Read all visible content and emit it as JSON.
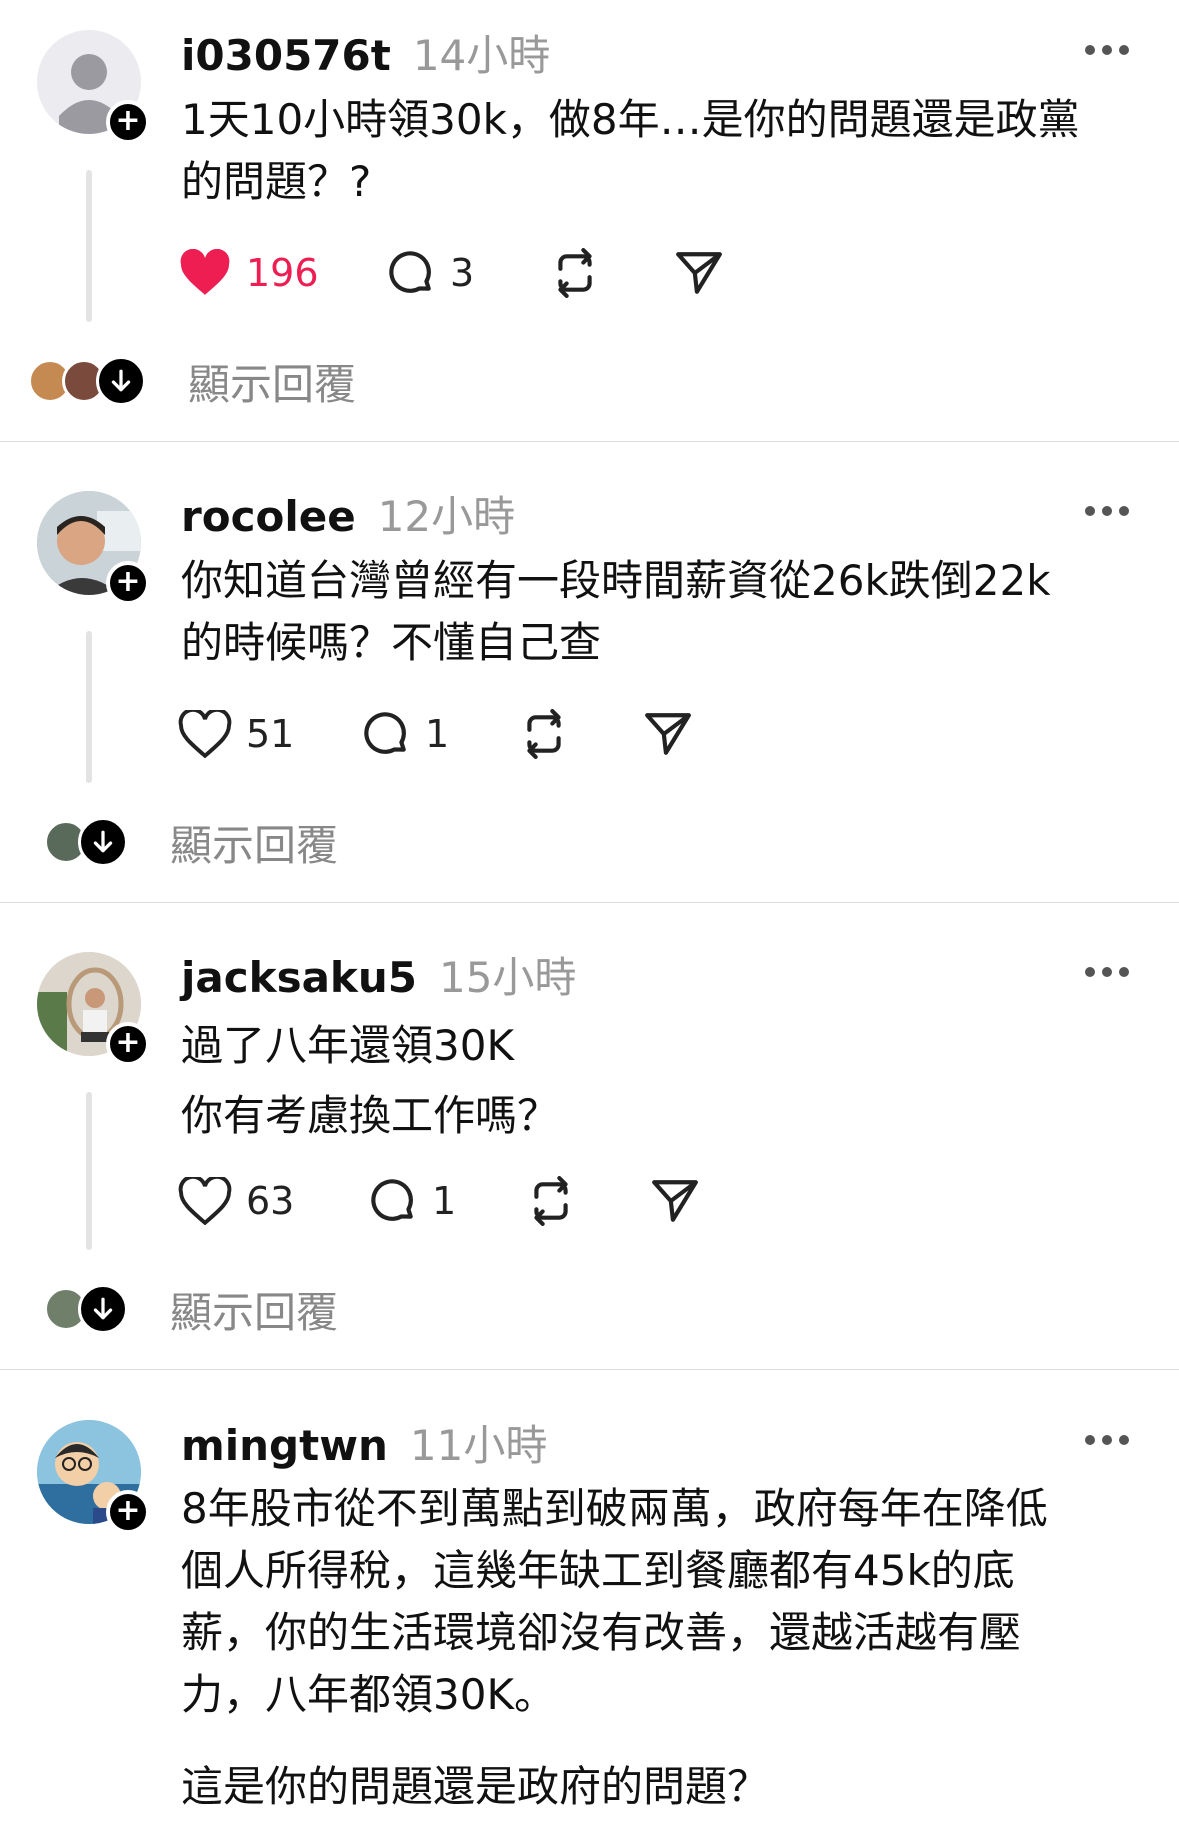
{
  "posts": [
    {
      "username": "i030576t",
      "time": "14小時",
      "lines": [
        "1天10小時領30k，做8年…是你的問題還是政黨",
        "的問題？?"
      ],
      "likes": "196",
      "liked": true,
      "comments": "3",
      "show_replies": "顯示回覆"
    },
    {
      "username": "rocolee",
      "time": "12小時",
      "lines": [
        "你知道台灣曾經有一段時間薪資從26k跌倒22k",
        "的時候嗎？不懂自己查"
      ],
      "likes": "51",
      "liked": false,
      "comments": "1",
      "show_replies": "顯示回覆"
    },
    {
      "username": "jacksaku5",
      "time": "15小時",
      "lines": [
        "過了八年還領30K",
        "你有考慮換工作嗎？"
      ],
      "likes": "63",
      "liked": false,
      "comments": "1",
      "show_replies": "顯示回覆"
    },
    {
      "username": "mingtwn",
      "time": "11小時",
      "lines": [
        "8年股市從不到萬點到破兩萬，政府每年在降低",
        "個人所得稅，這幾年缺工到餐廳都有45k的底",
        "薪，你的生活環境卻沒有改善，還越活越有壓",
        "力，八年都領30K。"
      ],
      "extra": "這是你的問題還是政府的問題？"
    }
  ],
  "icons": {
    "follow": "plus-icon",
    "more": "more-dots-icon",
    "like": "heart-icon",
    "comment": "comment-bubble-icon",
    "repost": "repost-icon",
    "share": "send-icon",
    "replies": "arrow-down-icon"
  },
  "colors": {
    "like_active": "#ee1d52",
    "muted": "#999999",
    "divider": "#dcdcdc"
  }
}
